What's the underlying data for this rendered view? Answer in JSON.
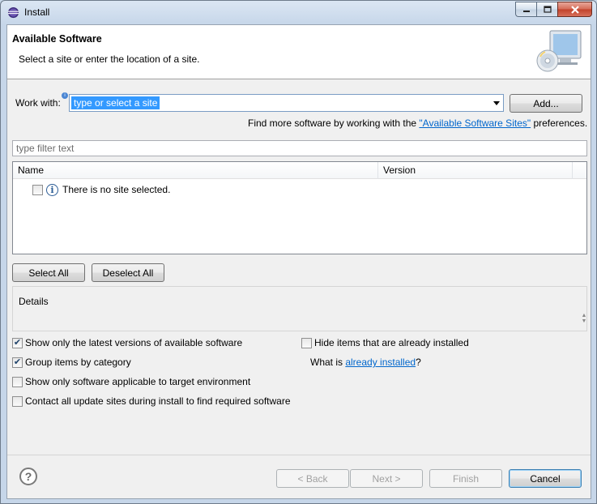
{
  "window": {
    "title": "Install"
  },
  "header": {
    "title": "Available Software",
    "subtitle": "Select a site or enter the location of a site."
  },
  "work_with": {
    "label": "Work with:",
    "placeholder": "type or select a site",
    "add_button": "Add...",
    "find_more_prefix": "Find more software by working with the ",
    "find_more_link": "\"Available Software Sites\"",
    "find_more_suffix": " preferences."
  },
  "filter": {
    "placeholder": "type filter text"
  },
  "table": {
    "columns": [
      "Name",
      "Version"
    ],
    "rows": [
      {
        "label": "There is no site selected.",
        "checked": false,
        "icon": "info-icon"
      }
    ]
  },
  "selection_buttons": {
    "select_all": "Select All",
    "deselect_all": "Deselect All"
  },
  "details": {
    "label": "Details"
  },
  "options": {
    "latest_versions": {
      "label": "Show only the latest versions of available software",
      "checked": true
    },
    "group_by_category": {
      "label": "Group items by category",
      "checked": true
    },
    "target_env": {
      "label": "Show only software applicable to target environment",
      "checked": false
    },
    "contact_sites": {
      "label": "Contact all update sites during install to find required software",
      "checked": false
    },
    "hide_installed": {
      "label": "Hide items that are already installed",
      "checked": false
    },
    "what_is_prefix": "What is ",
    "what_is_link": "already installed",
    "what_is_suffix": "?"
  },
  "footer": {
    "help_icon": "?",
    "back": "< Back",
    "next": "Next >",
    "finish": "Finish",
    "cancel": "Cancel"
  },
  "colors": {
    "link": "#0066cc",
    "selection": "#3399ff",
    "client_bg": "#f0f0f0"
  }
}
